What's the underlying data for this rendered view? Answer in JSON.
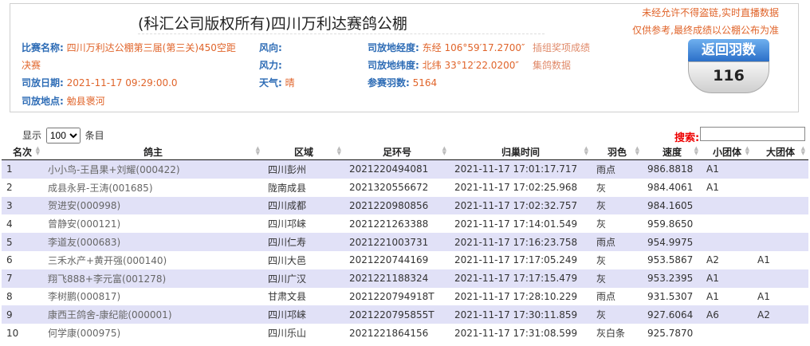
{
  "header": {
    "title": "(科汇公司版权所有)四川万利达赛鸽公棚",
    "warning_1": "未经允许不得盗链,实时直播数据",
    "warning_2": "仅供参考,最终成绩以公棚公布为准",
    "race_name_label": "比赛名称:",
    "race_name_value": "四川万利达公棚第三届(第三关)450空距",
    "race_name_value_2": "决赛",
    "release_date_label": "司放日期:",
    "release_date_value": "2021-11-17 09:29:00.0",
    "release_place_label": "司放地点:",
    "release_place_value": "勉县褒河",
    "wind_dir_label": "风向:",
    "wind_force_label": "风力:",
    "weather_label": "天气:",
    "weather_value": "晴",
    "longitude_label": "司放地经度:",
    "longitude_value": "东经 106°59′17.2700″",
    "latitude_label": "司放地纬度:",
    "latitude_value": "北纬 33°12′22.0200″",
    "count_label": "参赛羽数:",
    "count_value": "5164",
    "link_1": "插组奖项成绩",
    "link_2": "集鸽数据",
    "return_label": "返回羽数",
    "return_value": "116"
  },
  "controls": {
    "show_label": "显示",
    "page_size": "100",
    "entries_label": "条目",
    "search_label": "搜索:",
    "search_value": ""
  },
  "table": {
    "columns": [
      "名次",
      "鸽主",
      "区域",
      "足环号",
      "归巢时间",
      "羽色",
      "速度",
      "小团体",
      "大团体"
    ],
    "rows": [
      [
        "1",
        "小小鸟-王昌果+刘耀(000422)",
        "四川彭州",
        "2021220494081",
        "2021-11-17 17:01:17.717",
        "雨点",
        "986.8818",
        "A1",
        ""
      ],
      [
        "2",
        "成县永昇-王涛(001685)",
        "陇南成县",
        "2021320556672",
        "2021-11-17 17:02:25.968",
        "灰",
        "984.4061",
        "A1",
        ""
      ],
      [
        "3",
        "贺进安(000998)",
        "四川成都",
        "2021220980856",
        "2021-11-17 17:02:32.757",
        "灰",
        "984.1605",
        "",
        ""
      ],
      [
        "4",
        "曾静安(000121)",
        "四川邛崃",
        "2021221263388",
        "2021-11-17 17:14:01.549",
        "灰",
        "959.8650",
        "",
        ""
      ],
      [
        "5",
        "李道友(000683)",
        "四川仁寿",
        "2021221003731",
        "2021-11-17 17:16:23.758",
        "雨点",
        "954.9975",
        "",
        ""
      ],
      [
        "6",
        "三禾水产+黄开强(000140)",
        "四川大邑",
        "2021220744169",
        "2021-11-17 17:17:05.249",
        "灰",
        "953.5867",
        "A2",
        "A1"
      ],
      [
        "7",
        "翔飞888+李元富(001278)",
        "四川广汉",
        "2021221188324",
        "2021-11-17 17:17:15.479",
        "灰",
        "953.2395",
        "A1",
        ""
      ],
      [
        "8",
        "李树鹏(000817)",
        "甘肃文县",
        "2021220794918T",
        "2021-11-17 17:28:10.229",
        "雨点",
        "931.5307",
        "A1",
        "A1"
      ],
      [
        "9",
        "康西王鸽舍-康纪能(000001)",
        "四川邛崃",
        "2021220795855T",
        "2021-11-17 17:30:11.859",
        "灰",
        "927.6064",
        "A6",
        "A2"
      ],
      [
        "10",
        "何学康(000975)",
        "四川乐山",
        "2021221864156",
        "2021-11-17 17:31:08.599",
        "灰白条",
        "925.7870",
        "",
        ""
      ]
    ]
  }
}
